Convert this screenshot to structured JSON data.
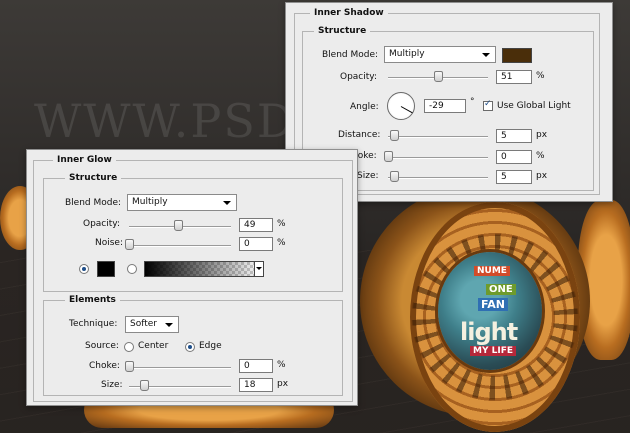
{
  "watermark": "WWW.PSD-DUDE.COM",
  "artwork_labels": {
    "nume": "NUME",
    "one": "ONE",
    "fan": "FAN",
    "light": "light",
    "my_life": "MY LIFE"
  },
  "inner_shadow": {
    "title": "Inner Shadow",
    "structure_label": "Structure",
    "blend_mode_label": "Blend Mode:",
    "blend_mode_value": "Multiply",
    "color": "#4a2e0a",
    "opacity_label": "Opacity:",
    "opacity_value": "51",
    "opacity_unit": "%",
    "opacity_slider": 0.51,
    "angle_label": "Angle:",
    "angle_value": "-29",
    "angle_unit": "°",
    "use_global_light_label": "Use Global Light",
    "use_global_light_checked": true,
    "distance_label": "Distance:",
    "distance_value": "5",
    "distance_unit": "px",
    "choke_label": "hoke:",
    "choke_value": "0",
    "choke_unit": "%",
    "size_label": "Size:",
    "size_value": "5",
    "size_unit": "px"
  },
  "inner_glow": {
    "title": "Inner Glow",
    "structure_label": "Structure",
    "blend_mode_label": "Blend Mode:",
    "blend_mode_value": "Multiply",
    "opacity_label": "Opacity:",
    "opacity_value": "49",
    "opacity_unit": "%",
    "opacity_slider": 0.49,
    "noise_label": "Noise:",
    "noise_value": "0",
    "noise_unit": "%",
    "glow_color": "#000000",
    "elements_label": "Elements",
    "technique_label": "Technique:",
    "technique_value": "Softer",
    "source_label": "Source:",
    "source_center_label": "Center",
    "source_edge_label": "Edge",
    "source_selected": "Edge",
    "choke_label": "Choke:",
    "choke_value": "0",
    "choke_unit": "%",
    "size_label": "Size:",
    "size_value": "18",
    "size_unit": "px"
  }
}
